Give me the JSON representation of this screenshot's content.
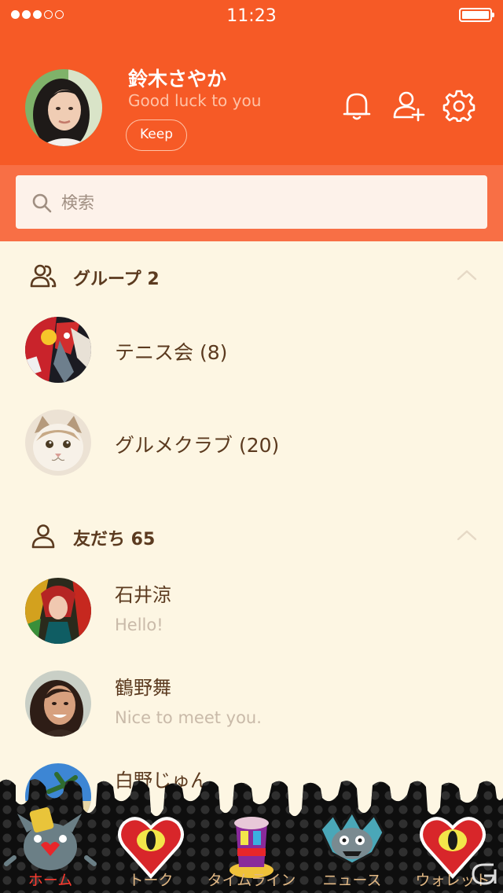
{
  "status_bar": {
    "time": "11:23",
    "signal_bars": 3,
    "signal_total": 5
  },
  "profile": {
    "name": "鈴木さやか",
    "status_message": "Good luck to you",
    "keep_label": "Keep"
  },
  "header_icons": [
    "bell-icon",
    "add-friend-icon",
    "settings-icon"
  ],
  "search": {
    "placeholder": "検索"
  },
  "groups": {
    "title": "グループ 2",
    "items": [
      {
        "label": "テニス会 (8)"
      },
      {
        "label": "グルメクラブ (20)"
      }
    ]
  },
  "friends": {
    "title": "友だち 65",
    "items": [
      {
        "name": "石井涼",
        "status": "Hello!"
      },
      {
        "name": "鶴野舞",
        "status": "Nice to meet you."
      },
      {
        "name": "白野じゅん",
        "status": ""
      }
    ]
  },
  "tabs": [
    {
      "label": "ホーム",
      "active": true
    },
    {
      "label": "トーク",
      "active": false
    },
    {
      "label": "タイムライン",
      "active": false
    },
    {
      "label": "ニュース",
      "active": false
    },
    {
      "label": "ウォレット",
      "active": false
    }
  ],
  "colors": {
    "header": "#f65a26",
    "search_band": "#f86f45",
    "background": "#fdf6e3",
    "text_primary": "#5b3a1f",
    "text_muted": "#c9baa9",
    "tab_active": "#ff3b2f",
    "tab_inactive": "#e3b985"
  }
}
